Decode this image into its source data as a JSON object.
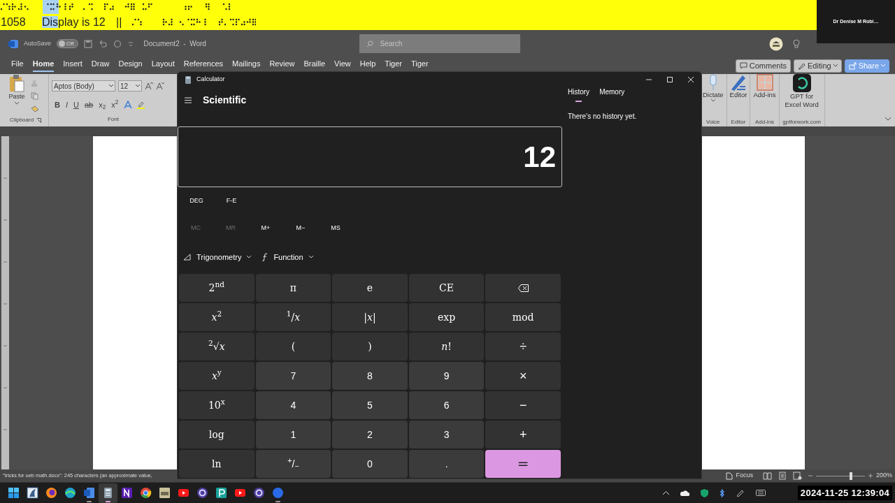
{
  "caption_bar": {
    "line_number": "1058",
    "caption_parts": [
      {
        "text": "Dis",
        "selected": true
      },
      {
        "text": "play is 12",
        "selected": false
      }
    ],
    "separator": "||"
  },
  "participant": {
    "name": "Dr Denise M Robi…"
  },
  "word": {
    "title_bar": {
      "autosave_label": "AutoSave",
      "autosave": {
        "on": false,
        "label": "Off"
      },
      "document_title": "Document2  -  Word",
      "search": {
        "placeholder": "Search"
      }
    },
    "menu_tabs": [
      {
        "label": "File",
        "selected": false
      },
      {
        "label": "Home",
        "selected": true
      },
      {
        "label": "Insert",
        "selected": false
      },
      {
        "label": "Draw",
        "selected": false
      },
      {
        "label": "Design",
        "selected": false
      },
      {
        "label": "Layout",
        "selected": false
      },
      {
        "label": "References",
        "selected": false
      },
      {
        "label": "Mailings",
        "selected": false
      },
      {
        "label": "Review",
        "selected": false
      },
      {
        "label": "Braille",
        "selected": false
      },
      {
        "label": "View",
        "selected": false
      },
      {
        "label": "Help",
        "selected": false
      },
      {
        "label": "Tiger",
        "selected": false
      },
      {
        "label": "Tiger",
        "selected": false
      }
    ],
    "actions": [
      {
        "label": "Comments",
        "kind": "comments"
      },
      {
        "label": "Editing",
        "kind": "editing"
      },
      {
        "label": "Share",
        "kind": "share"
      }
    ],
    "ribbon": {
      "clipboard": {
        "paste": "Paste",
        "group": "Clipboard"
      },
      "font": {
        "font_name": "Aptos (Body)",
        "font_size": "12",
        "group": "Font",
        "buttons": [
          {
            "label": "B",
            "kind": "bold"
          },
          {
            "label": "I",
            "kind": "italic"
          },
          {
            "label": "U",
            "kind": "underline"
          },
          {
            "label": "ab",
            "kind": "strike"
          },
          {
            "label": "x$_{2}$",
            "kind": "plain"
          },
          {
            "label": "x$^{2}$",
            "kind": "plain"
          }
        ]
      },
      "groups": [
        {
          "label": "Dictate",
          "group": "Voice",
          "kind": "mic"
        },
        {
          "label": "Editor",
          "group": "Editor",
          "kind": "pen"
        },
        {
          "label": "Add-ins",
          "group": "Add-ins",
          "kind": "grid"
        },
        {
          "label": "GPT for Excel Word",
          "group": "gptforwork.com",
          "kind": "gpt"
        }
      ]
    },
    "status_bar": {
      "text": "\"tricks for ueb math.docx\": 245 characters (an approximate value,",
      "focus": "Focus",
      "zoom": {
        "level": 0.72,
        "reading": "200%"
      }
    }
  },
  "calculator": {
    "title": "Calculator",
    "mode": "Scientific",
    "panel_tabs": [
      {
        "label": "History",
        "selected": true
      },
      {
        "label": "Memory",
        "selected": false
      }
    ],
    "history_empty": "There’s no history yet.",
    "display": "12",
    "toggles": [
      "DEG",
      "F-E"
    ],
    "memory": [
      {
        "label": "MC",
        "disabled": true
      },
      {
        "label": "MR",
        "disabled": true
      },
      {
        "label": "M+",
        "disabled": false
      },
      {
        "label": "M−",
        "disabled": false
      },
      {
        "label": "MS",
        "disabled": false
      }
    ],
    "menus": [
      {
        "label": "Trigonometry",
        "kind": "trig"
      },
      {
        "label": "Function",
        "kind": "function"
      }
    ],
    "keys": [
      {
        "label": "2$^{nd}$",
        "kind": "function"
      },
      {
        "label": "π",
        "kind": "function"
      },
      {
        "label": "e",
        "kind": "function"
      },
      {
        "label": "CE",
        "kind": "function"
      },
      {
        "kind": "backspace"
      },
      {
        "label": "*x*$^{2}$",
        "kind": "function"
      },
      {
        "label": "$^{1}$/*x*",
        "kind": "function"
      },
      {
        "label": "|*x*|",
        "kind": "function"
      },
      {
        "label": "exp",
        "kind": "function"
      },
      {
        "label": "mod",
        "kind": "function"
      },
      {
        "label": "$^{2}$√*x*",
        "kind": "function"
      },
      {
        "label": "(",
        "kind": "function"
      },
      {
        "label": ")",
        "kind": "function"
      },
      {
        "label": "*n*!",
        "kind": "function"
      },
      {
        "label": "÷",
        "kind": "operator"
      },
      {
        "label": "*x*$^{y}$",
        "kind": "function"
      },
      {
        "label": "7",
        "kind": "number"
      },
      {
        "label": "8",
        "kind": "number"
      },
      {
        "label": "9",
        "kind": "number"
      },
      {
        "label": "×",
        "kind": "operator"
      },
      {
        "label": "10$^{x}$",
        "kind": "function"
      },
      {
        "label": "4",
        "kind": "number"
      },
      {
        "label": "5",
        "kind": "number"
      },
      {
        "label": "6",
        "kind": "number"
      },
      {
        "label": "−",
        "kind": "operator"
      },
      {
        "label": "log",
        "kind": "function"
      },
      {
        "label": "1",
        "kind": "number"
      },
      {
        "label": "2",
        "kind": "number"
      },
      {
        "label": "3",
        "kind": "number"
      },
      {
        "label": "+",
        "kind": "operator"
      },
      {
        "label": "ln",
        "kind": "function"
      },
      {
        "label": "$^{+}$/$_{−}$",
        "kind": "number"
      },
      {
        "label": "0",
        "kind": "number"
      },
      {
        "label": ".",
        "kind": "number"
      },
      {
        "label": "=",
        "kind": "equals"
      }
    ]
  },
  "taskbar": {
    "apps": [
      {
        "kind": "start",
        "running": false,
        "selected": false
      },
      {
        "kind": "shark",
        "running": false,
        "selected": false
      },
      {
        "kind": "firefox",
        "running": false,
        "selected": false
      },
      {
        "kind": "edge",
        "running": false,
        "selected": false
      },
      {
        "kind": "word",
        "running": true,
        "selected": false
      },
      {
        "kind": "calculator",
        "running": true,
        "selected": true
      },
      {
        "kind": "tile_purple",
        "running": false,
        "selected": false
      },
      {
        "kind": "chrome",
        "running": false,
        "selected": false
      },
      {
        "kind": "tile_beige",
        "running": false,
        "selected": false
      },
      {
        "kind": "video",
        "running": false,
        "selected": false
      },
      {
        "kind": "wheel",
        "running": false,
        "selected": false
      },
      {
        "kind": "tile_teal",
        "running": false,
        "selected": false
      },
      {
        "kind": "video",
        "running": false,
        "selected": false
      },
      {
        "kind": "wheel",
        "running": false,
        "selected": false
      },
      {
        "kind": "dot",
        "running": true,
        "selected": false
      }
    ],
    "datetime": "2024-11-25 12:39:04"
  }
}
